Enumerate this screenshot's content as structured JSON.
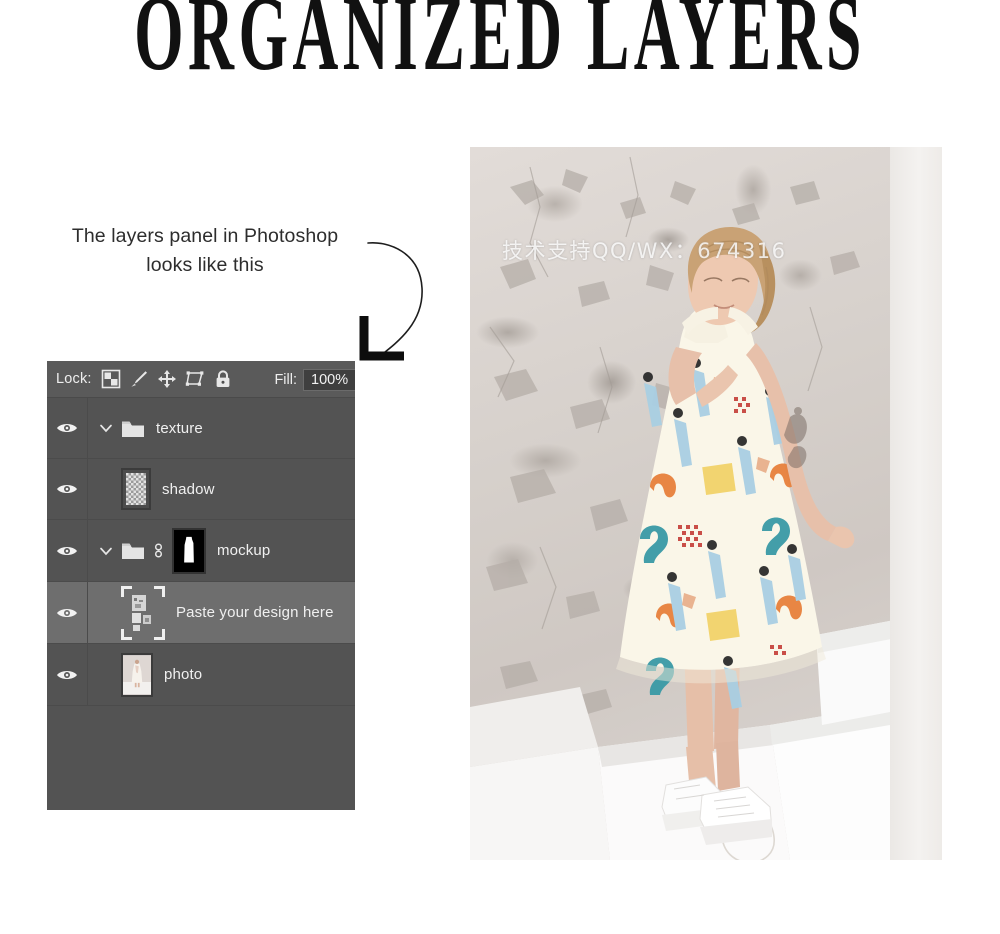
{
  "page": {
    "title": "ORGANIZED LAYERS",
    "background_color": "#ffffff"
  },
  "annotation": {
    "line1": "The layers panel in Photoshop",
    "line2": "looks like this",
    "arrow_icon": "curved-arrow-down-left-icon"
  },
  "layers_panel": {
    "background_color": "#535353",
    "selected_row_color": "#6e6e6e",
    "lock_bar": {
      "label": "Lock:",
      "icons": [
        {
          "name": "lock-transparent-pixels-icon",
          "title": "Lock transparent pixels"
        },
        {
          "name": "lock-image-pixels-icon",
          "title": "Lock image pixels"
        },
        {
          "name": "lock-position-icon",
          "title": "Lock position"
        },
        {
          "name": "lock-artboard-nesting-icon",
          "title": "Prevent auto-nesting"
        },
        {
          "name": "lock-all-icon",
          "title": "Lock all"
        }
      ],
      "fill_label": "Fill:",
      "fill_value": "100%"
    },
    "rows": [
      {
        "name": "texture",
        "type": "group",
        "visible": true,
        "expanded": true,
        "selected": false,
        "has_folder": true,
        "has_link": false,
        "thumb": "none"
      },
      {
        "name": "shadow",
        "type": "layer",
        "visible": true,
        "expanded": false,
        "selected": false,
        "has_folder": false,
        "has_link": false,
        "thumb": "checker"
      },
      {
        "name": "mockup",
        "type": "group",
        "visible": true,
        "expanded": true,
        "selected": false,
        "has_folder": true,
        "has_link": true,
        "thumb": "mask"
      },
      {
        "name": "Paste your design here",
        "type": "smart-object",
        "visible": true,
        "expanded": false,
        "selected": true,
        "has_folder": false,
        "has_link": false,
        "thumb": "smart-object"
      },
      {
        "name": "photo",
        "type": "layer",
        "visible": true,
        "expanded": false,
        "selected": false,
        "has_folder": false,
        "has_link": false,
        "thumb": "photo"
      }
    ]
  },
  "preview": {
    "watermark": "技术支持QQ/WX：674316",
    "alt": "Woman in patterned midi dress standing on white steps against a distressed plaster wall"
  }
}
